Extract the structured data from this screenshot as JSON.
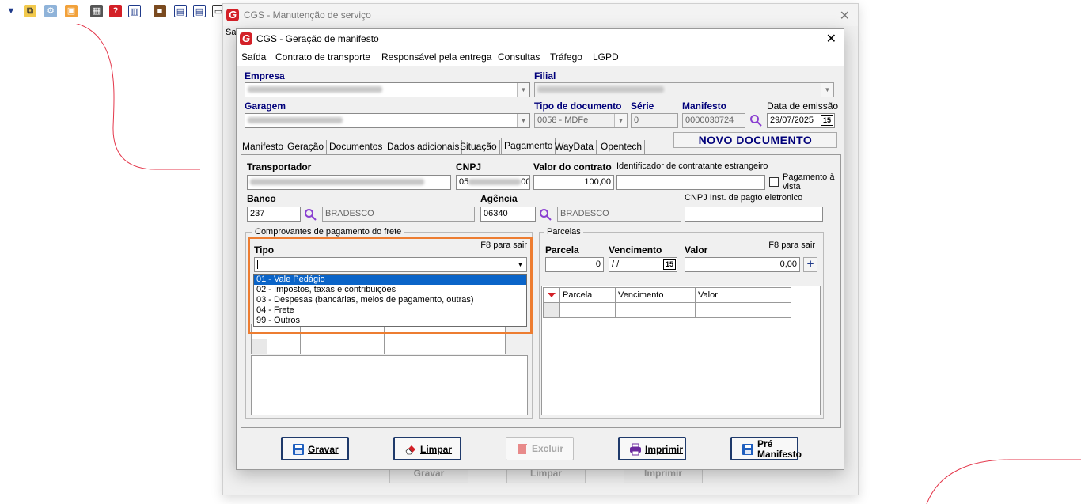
{
  "background_window": {
    "title": "CGS - Manutenção de serviço",
    "partial_label": "Saí",
    "buttons": [
      "Gravar",
      "Limpar",
      "Imprimir"
    ]
  },
  "dialog": {
    "title": "CGS - Geração de manifesto",
    "menu": [
      "Saída",
      "Contrato de transporte",
      "Responsável pela entrega",
      "Consultas",
      "Tráfego",
      "LGPD"
    ],
    "header": {
      "empresa_label": "Empresa",
      "filial_label": "Filial",
      "garagem_label": "Garagem",
      "tipo_doc_label": "Tipo de documento",
      "tipo_doc_value": "0058 - MDFe",
      "serie_label": "Série",
      "serie_value": "0",
      "manifesto_label": "Manifesto",
      "manifesto_value": "0000030724",
      "data_emissao_label": "Data de emissão",
      "data_emissao_value": "29/07/2025",
      "calendar_badge": "15"
    },
    "tabs": [
      "Manifesto",
      "Geração",
      "Documentos",
      "Dados adicionais",
      "Situação",
      "Pagamento",
      "WayData",
      "Opentech"
    ],
    "active_tab": "Pagamento",
    "status_banner": "NOVO DOCUMENTO",
    "payment": {
      "transportador_label": "Transportador",
      "cnpj_label": "CNPJ",
      "cnpj_prefix": "05",
      "cnpj_suffix": "00",
      "valor_contrato_label": "Valor do contrato",
      "valor_contrato_value": "100,00",
      "identificador_label": "Identificador de contratante estrangeiro",
      "pagamento_vista_label": "Pagamento à vista",
      "banco_label": "Banco",
      "banco_code": "237",
      "banco_name": "BRADESCO",
      "agencia_label": "Agência",
      "agencia_code": "06340",
      "agencia_name": "BRADESCO",
      "cnpj_inst_label": "CNPJ Inst. de pagto eletronico"
    },
    "comprovantes": {
      "group_title": "Comprovantes de pagamento do frete",
      "tipo_label": "Tipo",
      "f8_hint": "F8 para sair",
      "options": [
        "01 - Vale Pedágio",
        "02 - Impostos, taxas e contribuições",
        "03 - Despesas (bancárias, meios de pagamento, outras)",
        "04 - Frete",
        "99 - Outros"
      ],
      "selected_index": 0
    },
    "parcelas": {
      "group_title": "Parcelas",
      "parcela_label": "Parcela",
      "parcela_value": "0",
      "vencimento_label": "Vencimento",
      "vencimento_value": " / /",
      "valor_label": "Valor",
      "valor_value": "0,00",
      "f8_hint": "F8 para sair",
      "grid_columns": [
        "Parcela",
        "Vencimento",
        "Valor"
      ]
    },
    "buttons": {
      "gravar": "Gravar",
      "limpar": "Limpar",
      "excluir": "Excluir",
      "imprimir": "Imprimir",
      "pre_manifesto_line1": "Pré",
      "pre_manifesto_line2": "Manifesto"
    }
  },
  "colors": {
    "accent_orange": "#ed7d31",
    "selection_blue": "#0a64c8",
    "label_blue": "#00007a",
    "button_border": "#1f3a6b"
  }
}
